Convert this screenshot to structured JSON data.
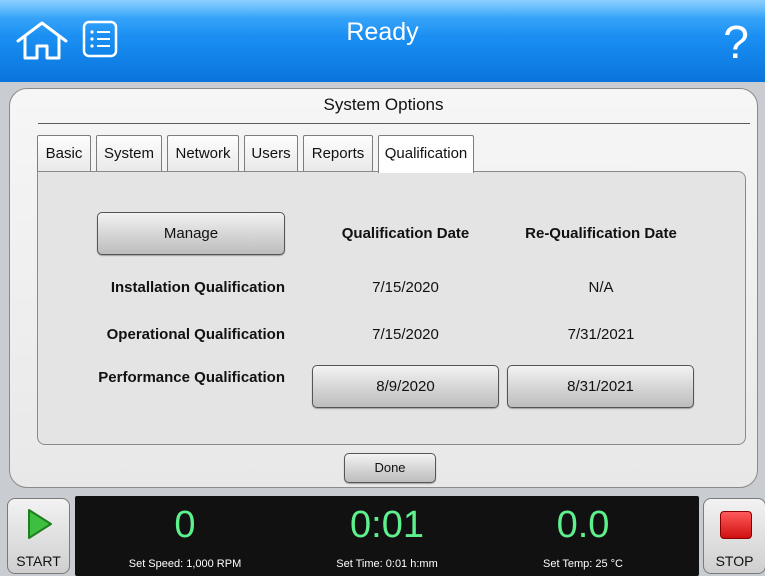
{
  "header": {
    "title": "Ready",
    "icons": [
      "home-icon",
      "list-menu-icon",
      "help-icon"
    ],
    "help_glyph": "?"
  },
  "dialog": {
    "title": "System Options",
    "tabs": [
      {
        "label": "Basic"
      },
      {
        "label": "System"
      },
      {
        "label": "Network"
      },
      {
        "label": "Users"
      },
      {
        "label": "Reports"
      },
      {
        "label": "Qualification",
        "active": true
      }
    ],
    "manage_label": "Manage",
    "columns": {
      "qualification_date": "Qualification Date",
      "requalification_date": "Re-Qualification Date"
    },
    "rows": [
      {
        "name": "Installation Qualification",
        "qualification_date": "7/15/2020",
        "requalification_date": "N/A"
      },
      {
        "name": "Operational Qualification",
        "qualification_date": "7/15/2020",
        "requalification_date": "7/31/2021"
      },
      {
        "name": "Performance Qualification",
        "qualification_date": "8/9/2020",
        "requalification_date": "8/31/2021"
      }
    ],
    "done_label": "Done"
  },
  "bottom": {
    "start_label": "START",
    "stop_label": "STOP",
    "speed_value": "0",
    "speed_set": "Set Speed: 1,000 RPM",
    "time_value": "0:01",
    "time_set": "Set Time: 0:01 h:mm",
    "temp_value": "0.0",
    "temp_set": "Set Temp: 25 °C"
  },
  "colors": {
    "header_blue": "#1a8ff2",
    "status_green": "#5ef08c",
    "stop_red": "#e01820",
    "start_green": "#3fbf3f"
  }
}
